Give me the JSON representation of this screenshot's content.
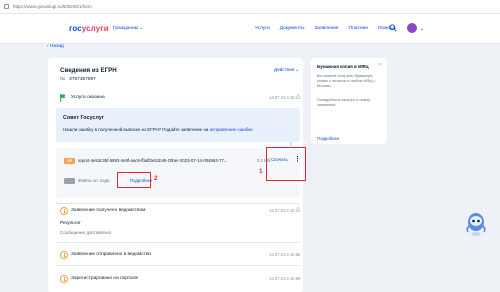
{
  "browser": {
    "url": "https://www.gosuslugi.ru/600206/1/form"
  },
  "header": {
    "logo_part1": "гос",
    "logo_part2": "услуги",
    "region": "Гражданам",
    "menu": [
      "Услуги",
      "Документы",
      "Заявления",
      "Платежи",
      "Помощь"
    ]
  },
  "back_label": "Назад",
  "card": {
    "title": "Сведения из ЕГРН",
    "id_label": "№",
    "id_value": "3757357897",
    "actions_label": "Действия",
    "status_done": "Услуга оказана",
    "status_done_time": "14.07.23 в 18:21",
    "tip_title": "Совет Госуслуг",
    "tip_text": "Нашли ошибку в полученной выписке из ЕГРН? Подайте заявление на",
    "tip_link": "исправление ошибки",
    "file": {
      "ext": "ZIP",
      "name": "report-4e53c35f-5893-4e8f-aac6-ffadf2e51b45-Other-2023-07-14-004863-77...",
      "size": "0.1 Мб",
      "download_label": "Скачать"
    },
    "signature": {
      "name": "Файлы эл. подп.",
      "more_label": "Подробнее"
    },
    "steps": [
      {
        "label": "Заявление получено ведомством",
        "time": "14.07.23 в 10:11",
        "detail1": "Результат",
        "detail2": "Сообщение доставлено"
      },
      {
        "label": "Заявление отправлено в ведомство",
        "time": "14.07.23 в 10:11"
      },
      {
        "label": "Зарегистрировано на портале",
        "time": "14.07.23 в 10:10"
      }
    ]
  },
  "annotations": {
    "box1": "1",
    "box2": "2"
  },
  "sidebar": {
    "title": "Бумажная копия в МФЦ",
    "text1": "Вы можете получить бумажную копию с печатью в любом МФЦ г. Москвы",
    "text2": "Понадобятся паспорт и номер заявления",
    "link": "Подробнее"
  },
  "colors": {
    "brand_blue": "#0d4cd3",
    "brand_red": "#ee3f58",
    "annotation_red": "#e0262e",
    "accent_orange": "#f0a44c"
  }
}
